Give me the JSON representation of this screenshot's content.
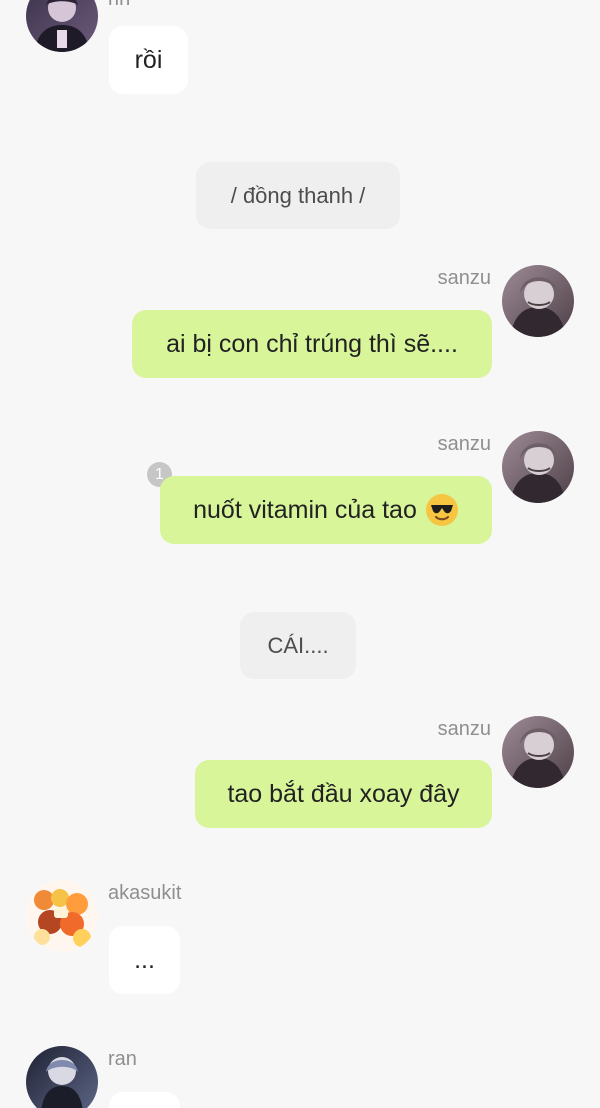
{
  "chat": {
    "messages": [
      {
        "type": "left",
        "sender": "rin",
        "avatar_icon": "rin-avatar-icon",
        "text": "rồi"
      },
      {
        "type": "narration",
        "text": "/ đồng thanh /"
      },
      {
        "type": "right",
        "sender": "sanzu",
        "avatar_icon": "sanzu-avatar-icon",
        "text": "ai bị con chỉ trúng thì sẽ...."
      },
      {
        "type": "right",
        "sender": "sanzu",
        "avatar_icon": "sanzu-avatar-icon",
        "text": "nuốt vitamin của tao",
        "emoji": "sunglasses-emoji-icon",
        "unread_count": "1"
      },
      {
        "type": "narration",
        "text": "CÁI...."
      },
      {
        "type": "right",
        "sender": "sanzu",
        "avatar_icon": "sanzu-avatar-icon",
        "text": "tao bắt đầu xoay đây"
      },
      {
        "type": "left",
        "sender": "akasukit",
        "avatar_icon": "akasukit-avatar-icon",
        "text": "..."
      },
      {
        "type": "left",
        "sender": "ran",
        "avatar_icon": "ran-avatar-icon",
        "text": ""
      }
    ]
  },
  "colors": {
    "background": "#f7f7f7",
    "left_bubble": "#ffffff",
    "right_bubble": "#d8f59a",
    "narration_bubble": "#efefef",
    "sender_name": "#8f8f8f",
    "unread_badge": "#c6c6c6"
  }
}
